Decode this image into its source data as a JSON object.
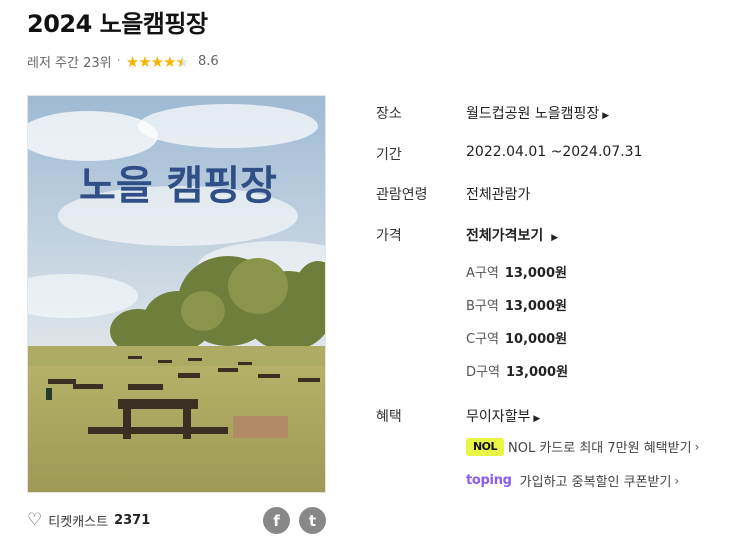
{
  "header": {
    "title": "2024 노을캠핑장",
    "category": "레저 주간 23위",
    "separator": "·",
    "rating_value": 4.3,
    "rating_max": 5,
    "score": "8.6"
  },
  "poster": {
    "headline": "노을 캠핑장"
  },
  "footer": {
    "heart_icon": "heart-outline-icon",
    "label": "티켓캐스트",
    "count": "2371",
    "facebook_glyph": "f",
    "twitter_glyph": "t"
  },
  "details": {
    "place_label": "장소",
    "place_value": "월드컵공원 노을캠핑장",
    "period_label": "기간",
    "period_value": "2022.04.01 ~2024.07.31",
    "age_label": "관람연령",
    "age_value": "전체관람가",
    "price_label": "가격",
    "price_all": "전체가격보기",
    "prices": [
      {
        "zone": "A구역",
        "amount": "13,000원"
      },
      {
        "zone": "B구역",
        "amount": "13,000원"
      },
      {
        "zone": "C구역",
        "amount": "10,000원"
      },
      {
        "zone": "D구역",
        "amount": "13,000원"
      }
    ],
    "benefit_label": "혜택",
    "benefit_value": "무이자할부",
    "promo_nol_badge": "NOL",
    "promo_nol_text": "NOL 카드로 최대 7만원 혜택받기",
    "promo_toping_badge": "toping",
    "promo_toping_text": "가입하고 중복할인 쿠폰받기"
  },
  "colors": {
    "star": "#f5b400",
    "nol_badge": "#e9f545",
    "toping": "#8a5cf0"
  }
}
